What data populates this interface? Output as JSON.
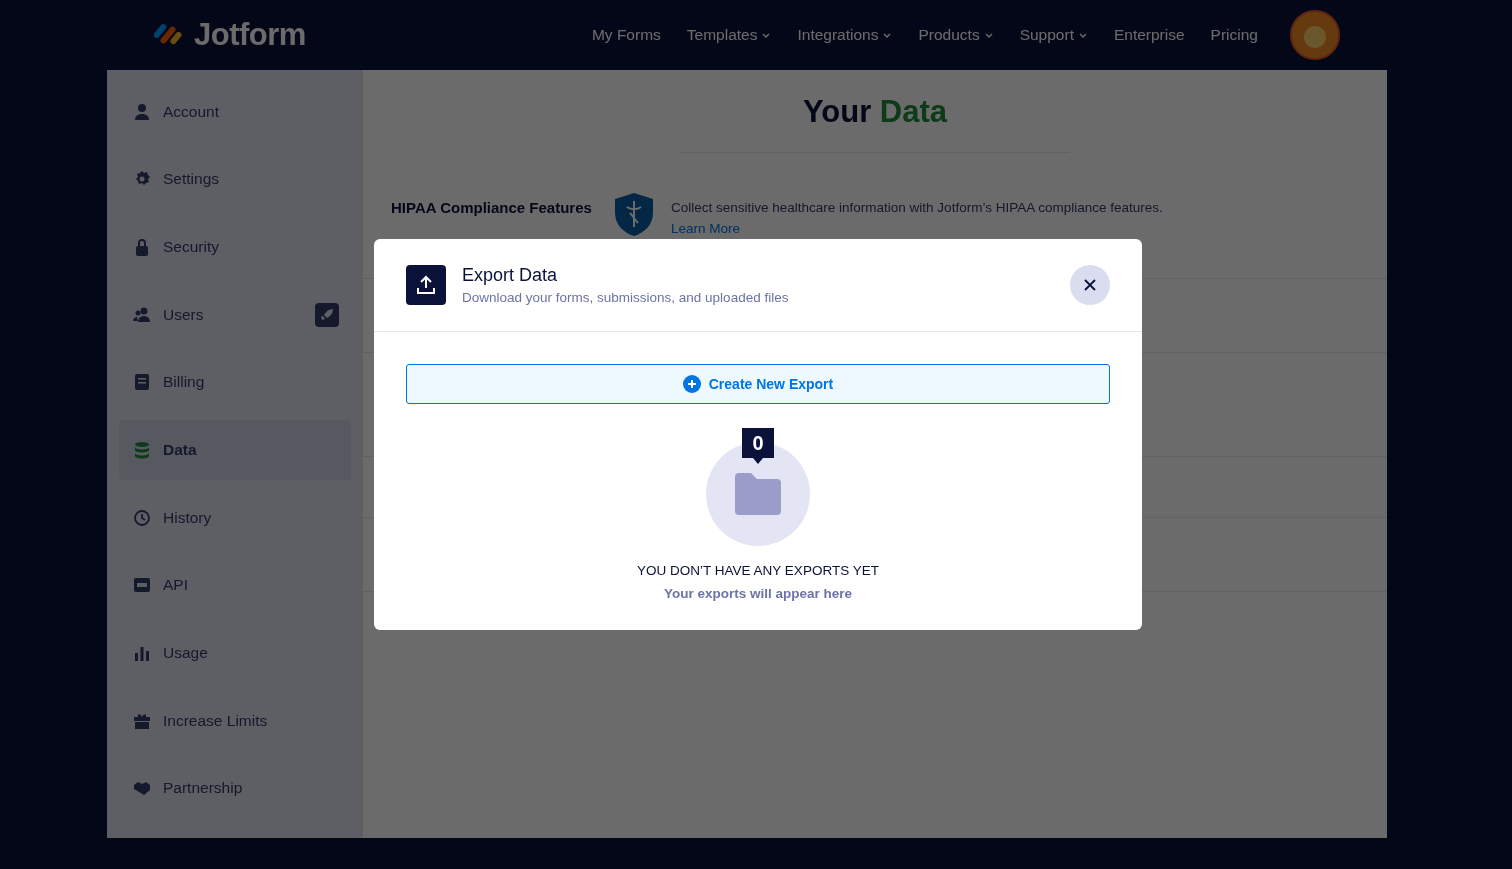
{
  "brand": "Jotform",
  "nav": [
    {
      "label": "My Forms",
      "dropdown": false
    },
    {
      "label": "Templates",
      "dropdown": true
    },
    {
      "label": "Integrations",
      "dropdown": true
    },
    {
      "label": "Products",
      "dropdown": true
    },
    {
      "label": "Support",
      "dropdown": true
    },
    {
      "label": "Enterprise",
      "dropdown": false
    },
    {
      "label": "Pricing",
      "dropdown": false
    }
  ],
  "sidebar": [
    {
      "label": "Account",
      "selected": false
    },
    {
      "label": "Settings",
      "selected": false
    },
    {
      "label": "Security",
      "selected": false
    },
    {
      "label": "Users",
      "selected": false
    },
    {
      "label": "Billing",
      "selected": false
    },
    {
      "label": "Data",
      "selected": true
    },
    {
      "label": "History",
      "selected": false
    },
    {
      "label": "API",
      "selected": false
    },
    {
      "label": "Usage",
      "selected": false
    },
    {
      "label": "Increase Limits",
      "selected": false
    },
    {
      "label": "Partnership",
      "selected": false
    }
  ],
  "main": {
    "title": "Your",
    "title_highlight": "Data",
    "hipaa": {
      "title": "HIPAA Compliance Features",
      "text": "Collect sensitive healthcare information with Jotform’s HIPAA compliance features.",
      "link": "Learn More"
    }
  },
  "modal": {
    "title": "Export Data",
    "subtitle": "Download your forms, submissions, and uploaded files",
    "create_button": "Create New Export",
    "count": "0",
    "empty_title": "YOU DON’T HAVE ANY EXPORTS YET",
    "empty_text": "Your exports will appear here"
  }
}
